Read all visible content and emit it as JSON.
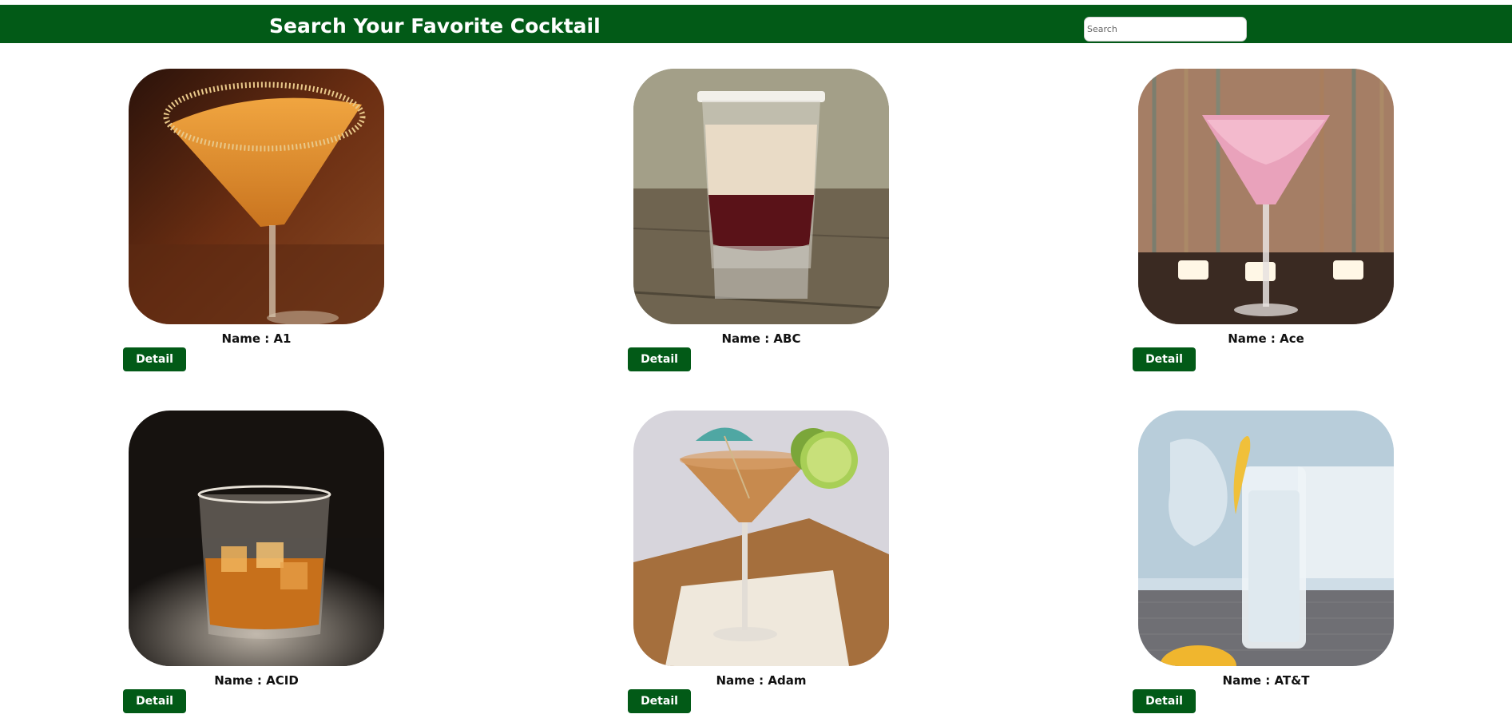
{
  "header": {
    "title": "Search Your Favorite Cocktail",
    "search_placeholder": "Search",
    "search_value": "",
    "background_color": "#025a17"
  },
  "cards": [
    {
      "name_label": "Name : A1",
      "detail_label": "Detail"
    },
    {
      "name_label": "Name : ABC",
      "detail_label": "Detail"
    },
    {
      "name_label": "Name : Ace",
      "detail_label": "Detail"
    },
    {
      "name_label": "Name : ACID",
      "detail_label": "Detail"
    },
    {
      "name_label": "Name : Adam",
      "detail_label": "Detail"
    },
    {
      "name_label": "Name : AT&T",
      "detail_label": "Detail"
    }
  ],
  "colors": {
    "accent": "#025a17",
    "button_text": "#ffffff"
  }
}
